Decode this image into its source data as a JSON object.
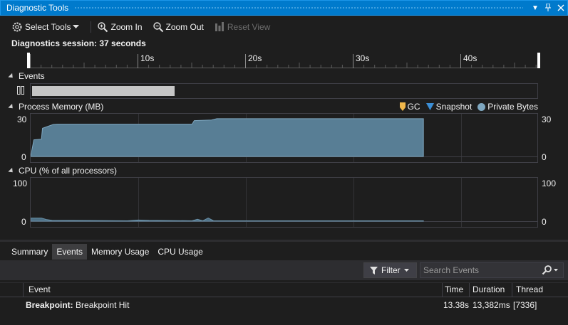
{
  "window": {
    "title": "Diagnostic Tools"
  },
  "toolbar": {
    "select_tools": "Select Tools",
    "zoom_in": "Zoom In",
    "zoom_out": "Zoom Out",
    "reset_view": "Reset View"
  },
  "session": {
    "label": "Diagnostics session: 37 seconds"
  },
  "timeline": {
    "ticks": [
      "10s",
      "20s",
      "30s",
      "40s"
    ]
  },
  "events_section": {
    "label": "Events"
  },
  "memory_section": {
    "label": "Process Memory (MB)",
    "y_max": "30",
    "y_min": "0",
    "legend": {
      "gc": "GC",
      "snapshot": "Snapshot",
      "private_bytes": "Private Bytes"
    },
    "colors": {
      "gc": "#f0b74b",
      "snapshot": "#3c8fd6",
      "private_bytes": "#7ea7c0",
      "fill": "#587e95"
    }
  },
  "cpu_section": {
    "label": "CPU (% of all processors)",
    "y_max": "100",
    "y_min": "0"
  },
  "chart_data": [
    {
      "type": "area",
      "title": "Process Memory (MB)",
      "xlabel": "seconds",
      "ylabel": "MB",
      "x": [
        0,
        0.3,
        1,
        1.1,
        2.1,
        2.5,
        15,
        15.2,
        16.8,
        17.3,
        36.5
      ],
      "y": [
        0,
        13,
        13.5,
        22,
        25,
        25.2,
        25.2,
        28,
        28.5,
        29.5,
        29.5
      ],
      "ylim": [
        0,
        30
      ],
      "xlim": [
        0,
        47.5
      ],
      "legend": [
        "GC",
        "Snapshot",
        "Private Bytes"
      ]
    },
    {
      "type": "area",
      "title": "CPU (% of all processors)",
      "xlabel": "seconds",
      "ylabel": "%",
      "x": [
        0,
        1,
        1.5,
        2,
        9,
        10,
        11,
        15,
        15.5,
        16,
        16.5,
        17,
        36.5
      ],
      "y": [
        8,
        8,
        4,
        2,
        1,
        3,
        2,
        1,
        5,
        1,
        8,
        1,
        1
      ],
      "ylim": [
        0,
        100
      ],
      "xlim": [
        0,
        47.5
      ]
    }
  ],
  "tabs": [
    "Summary",
    "Events",
    "Memory Usage",
    "CPU Usage"
  ],
  "active_tab": "Events",
  "filter": {
    "label": "Filter",
    "search_placeholder": "Search Events"
  },
  "grid": {
    "columns": {
      "event": "Event",
      "time": "Time",
      "duration": "Duration",
      "thread": "Thread"
    },
    "rows": [
      {
        "event_bold": "Breakpoint:",
        "event_text": "Breakpoint Hit",
        "time": "13.38s",
        "duration": "13,382ms",
        "thread": "[7336]"
      }
    ]
  }
}
